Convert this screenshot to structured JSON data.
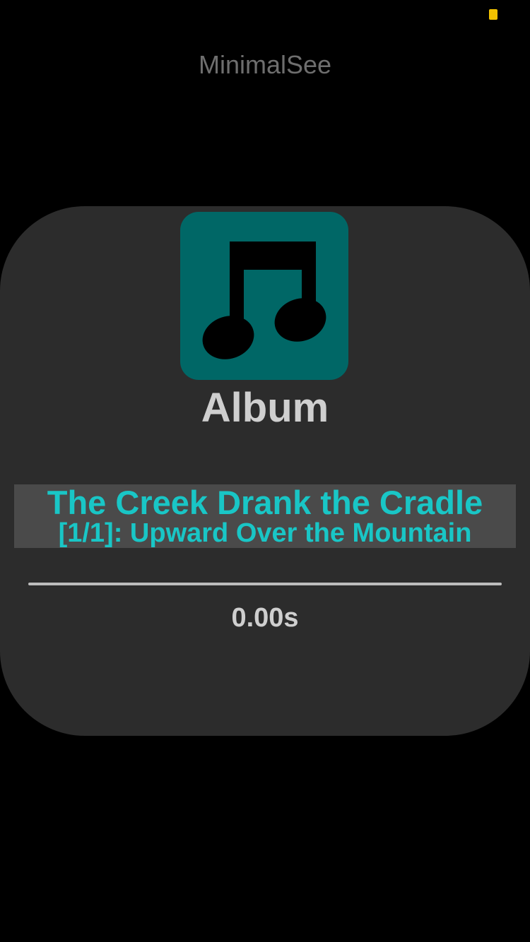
{
  "status_bar": {
    "indicator_color": "#f2c200"
  },
  "app": {
    "title": "MinimalSee"
  },
  "player": {
    "art_icon": "music-note-icon",
    "art_color": "#006766",
    "category_label": "Album",
    "track_title": "The Creek Drank the Cradle",
    "track_subtitle": "[1/1]: Upward Over the Mountain",
    "accent_color": "#19c6c6",
    "progress_fraction": 0,
    "elapsed_label": "0.00s"
  }
}
